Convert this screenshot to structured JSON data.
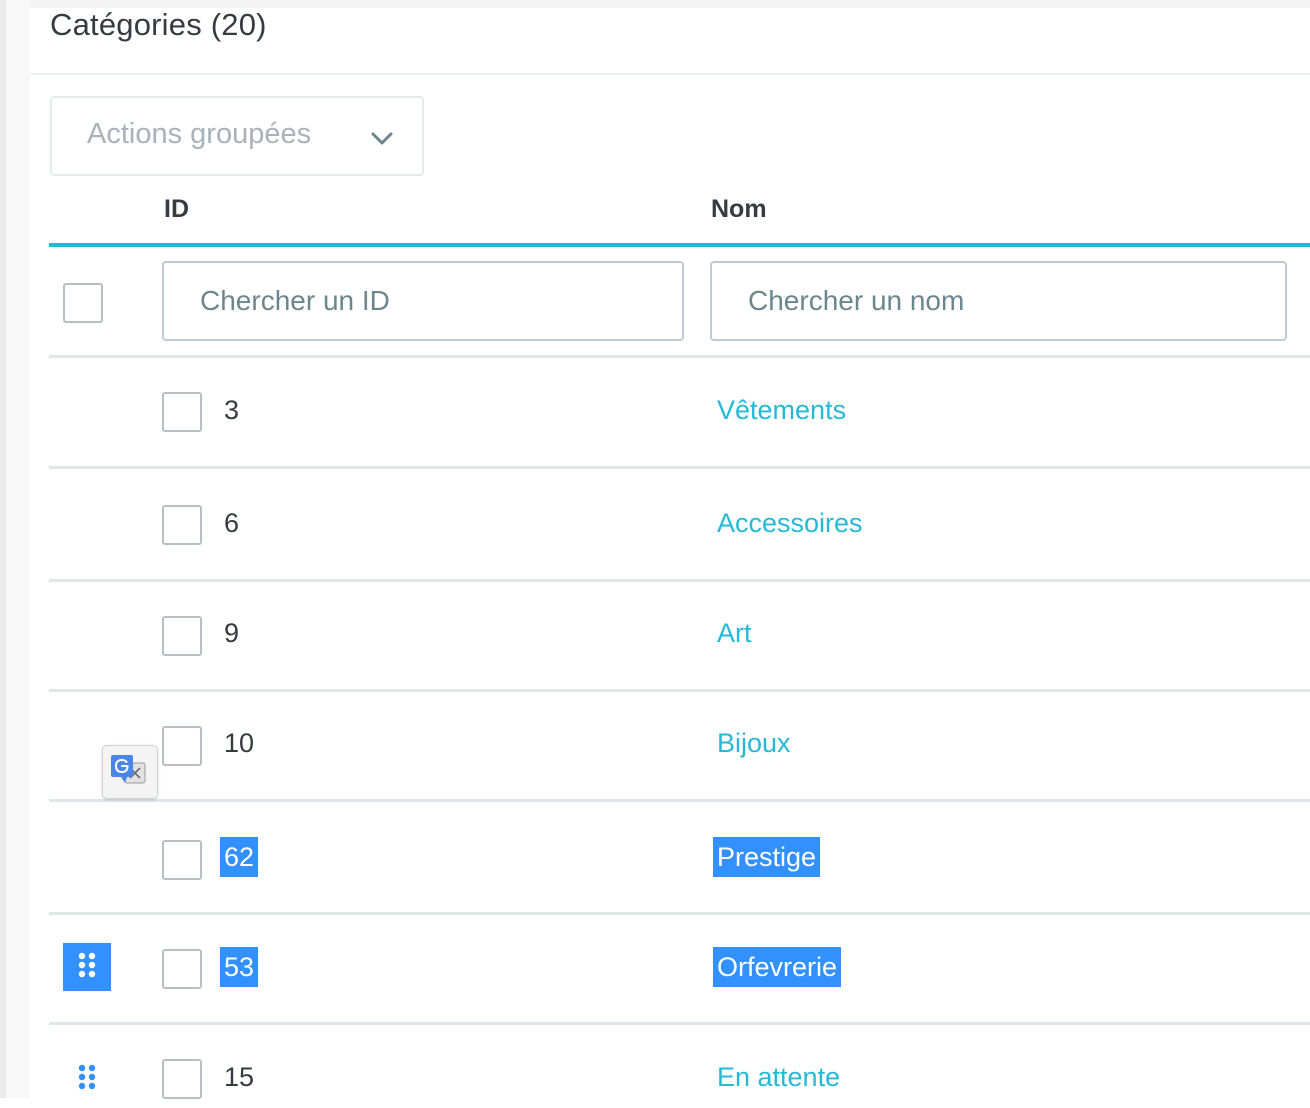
{
  "panel": {
    "title": "Catégories (20)"
  },
  "bulk_actions": {
    "label": "Actions groupées",
    "icon": "chevron-down-icon"
  },
  "table": {
    "columns": [
      "ID",
      "Nom"
    ],
    "filters": {
      "id_placeholder": "Chercher un ID",
      "name_placeholder": "Chercher un nom"
    },
    "rows": [
      {
        "id": "3",
        "name": "Vêtements",
        "selected": false,
        "drag_handle": false
      },
      {
        "id": "6",
        "name": "Accessoires",
        "selected": false,
        "drag_handle": false
      },
      {
        "id": "9",
        "name": "Art",
        "selected": false,
        "drag_handle": false
      },
      {
        "id": "10",
        "name": "Bijoux",
        "selected": false,
        "drag_handle": false
      },
      {
        "id": "62",
        "name": "Prestige",
        "selected": true,
        "drag_handle": false
      },
      {
        "id": "53",
        "name": "Orfevrerie",
        "selected": true,
        "drag_handle": true
      },
      {
        "id": "15",
        "name": "En attente",
        "selected": false,
        "drag_handle": true
      }
    ]
  },
  "colors": {
    "accent": "#25b9d7",
    "selection": "#3390ff",
    "text": "#363a41",
    "border": "#bbcdd2"
  },
  "overlay": {
    "icon": "google-translate-icon"
  }
}
